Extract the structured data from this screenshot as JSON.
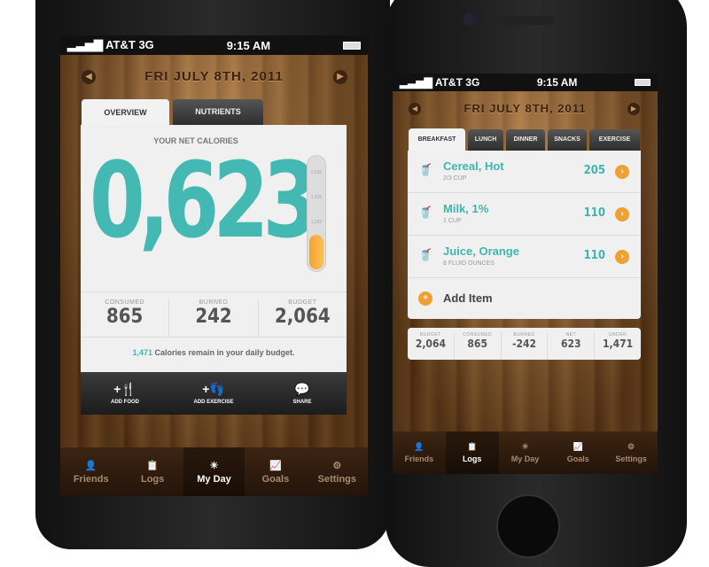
{
  "left": {
    "status": {
      "carrier": "AT&T",
      "network": "3G",
      "time": "9:15 AM"
    },
    "date": "FRI JULY 8TH, 2011",
    "tabs": [
      "OVERVIEW",
      "NUTRIENTS"
    ],
    "heading": "YOUR NET CALORIES",
    "net_calories": "0,623",
    "gauge": {
      "labels": [
        "2,500",
        "1,800",
        "1,200"
      ],
      "fill_percent": 30
    },
    "stats": [
      {
        "label": "CONSUMED",
        "value": "865"
      },
      {
        "label": "BURNED",
        "value": "242"
      },
      {
        "label": "BUDGET",
        "value": "2,064"
      }
    ],
    "remain_value": "1,471",
    "remain_text": "Calories remain in your daily budget.",
    "actions": [
      {
        "label": "ADD FOOD",
        "icon": "fork-knife-icon"
      },
      {
        "label": "ADD EXERCISE",
        "icon": "footprints-icon"
      },
      {
        "label": "SHARE",
        "icon": "speech-bubble-icon"
      }
    ],
    "tabbar": [
      {
        "label": "Friends",
        "icon": "person-icon"
      },
      {
        "label": "Logs",
        "icon": "clipboard-icon"
      },
      {
        "label": "My Day",
        "icon": "sun-icon",
        "selected": true
      },
      {
        "label": "Goals",
        "icon": "chart-icon"
      },
      {
        "label": "Settings",
        "icon": "gear-icon"
      }
    ]
  },
  "right": {
    "status": {
      "carrier": "AT&T",
      "network": "3G",
      "time": "9:15 AM"
    },
    "date": "FRI JULY 8TH, 2011",
    "tabs": [
      "BREAKFAST",
      "LUNCH",
      "DINNER",
      "SNACKS",
      "EXERCISE"
    ],
    "items": [
      {
        "name": "Cereal, Hot",
        "serving": "2/3 CUP",
        "calories": "205"
      },
      {
        "name": "Milk, 1%",
        "serving": "1 CUP",
        "calories": "110"
      },
      {
        "name": "Juice, Orange",
        "serving": "8 FLUID OUNCES",
        "calories": "110"
      }
    ],
    "add_item": "Add Item",
    "summary": [
      {
        "label": "BUDGET",
        "value": "2,064"
      },
      {
        "label": "CONSUMED",
        "value": "865"
      },
      {
        "label": "BURNED",
        "value": "-242"
      },
      {
        "label": "NET",
        "value": "623"
      },
      {
        "label": "UNDER",
        "value": "1,471"
      }
    ],
    "tabbar": [
      {
        "label": "Friends",
        "icon": "person-icon"
      },
      {
        "label": "Logs",
        "icon": "clipboard-icon",
        "selected": true
      },
      {
        "label": "My Day",
        "icon": "sun-icon"
      },
      {
        "label": "Goals",
        "icon": "chart-icon"
      },
      {
        "label": "Settings",
        "icon": "gear-icon"
      }
    ]
  },
  "colors": {
    "accent": "#3fb5b0",
    "orange": "#f0a030"
  }
}
